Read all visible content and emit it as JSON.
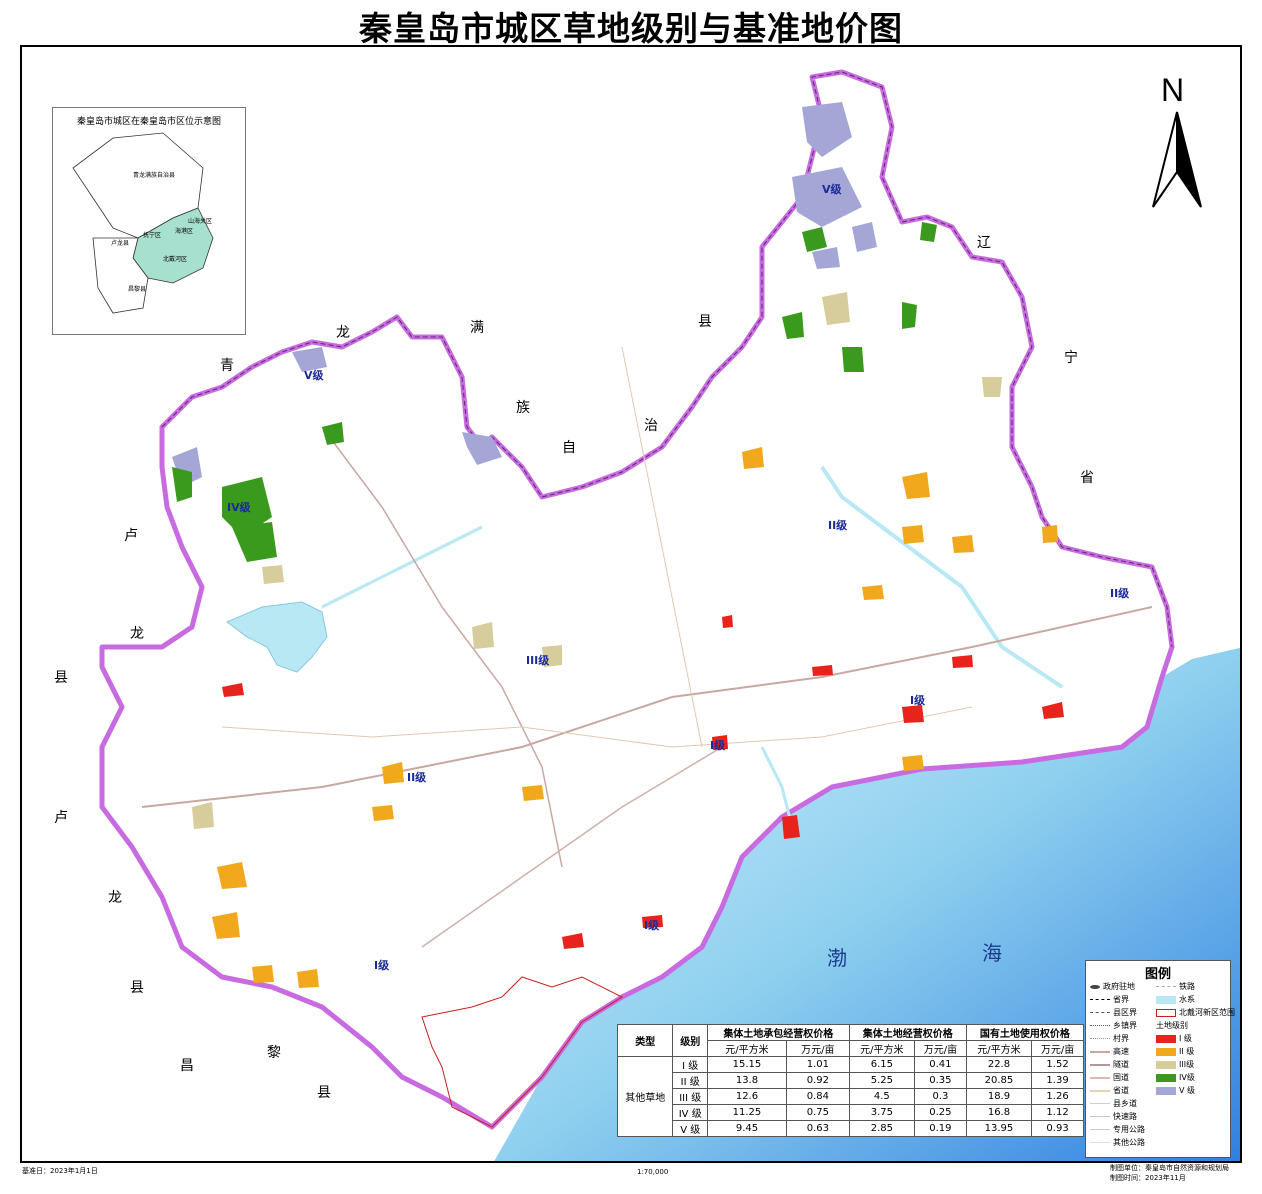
{
  "title": "秦皇岛市城区草地级别与基准地价图",
  "inset": {
    "title": "秦皇岛市城区在秦皇岛市区位示意图",
    "labels": [
      "青龙满族自治县",
      "抚宁区",
      "海港区",
      "卢龙县",
      "北戴河区",
      "山海关区",
      "昌黎县"
    ]
  },
  "compass": {
    "label": "N"
  },
  "place_labels": {
    "qinglong": [
      "青",
      "龙",
      "满",
      "族",
      "自",
      "治",
      "县"
    ],
    "liaoning": [
      "辽",
      "宁",
      "省"
    ],
    "lulong_top": [
      "卢",
      "龙",
      "县"
    ],
    "lulong_bottom": [
      "卢",
      "龙",
      "县"
    ],
    "changli": [
      "昌",
      "黎",
      "县"
    ],
    "bohai": [
      "渤",
      "海"
    ]
  },
  "grade_labels": [
    "V级",
    "V级",
    "IV级",
    "III级",
    "II级",
    "II级",
    "II级",
    "I级",
    "I级",
    "I级",
    "I级"
  ],
  "colors": {
    "grade_I": "#e8231c",
    "grade_II": "#f2a81d",
    "grade_III": "#d6cc9c",
    "grade_IV": "#3a9a1e",
    "grade_V": "#a4a6d6",
    "sea": "#3a8fe0",
    "sea_light": "#bfeaf5",
    "boundary": "#c86ae0",
    "water": "#b8e8f4"
  },
  "table": {
    "headers": {
      "type": "类型",
      "grade": "级别",
      "col1": "集体土地承包经营权价格",
      "col2": "集体土地经营权价格",
      "col3": "国有土地使用权价格"
    },
    "units": [
      "元/平方米",
      "万元/亩",
      "元/平方米",
      "万元/亩",
      "元/平方米",
      "万元/亩"
    ],
    "category": "其他草地",
    "rows": [
      {
        "grade": "I 级",
        "values": [
          "15.15",
          "1.01",
          "6.15",
          "0.41",
          "22.8",
          "1.52"
        ]
      },
      {
        "grade": "II 级",
        "values": [
          "13.8",
          "0.92",
          "5.25",
          "0.35",
          "20.85",
          "1.39"
        ]
      },
      {
        "grade": "III 级",
        "values": [
          "12.6",
          "0.84",
          "4.5",
          "0.3",
          "18.9",
          "1.26"
        ]
      },
      {
        "grade": "IV 级",
        "values": [
          "11.25",
          "0.75",
          "3.75",
          "0.25",
          "16.8",
          "1.12"
        ]
      },
      {
        "grade": "V 级",
        "values": [
          "9.45",
          "0.63",
          "2.85",
          "0.19",
          "13.95",
          "0.93"
        ]
      }
    ]
  },
  "legend": {
    "title": "图例",
    "left_items": [
      "政府驻地",
      "省界",
      "县区界",
      "乡镇界",
      "村界",
      "高速",
      "隧道",
      "国道",
      "省道",
      "县乡道",
      "快速路",
      "专用公路",
      "其他公路"
    ],
    "right_items": [
      "铁路",
      "水系",
      "北戴河新区范围",
      "土地级别",
      "I 级",
      "II 级",
      "III级",
      "IV级",
      "V 级"
    ]
  },
  "footer": {
    "base_date": "基准日：2023年1月1日",
    "scale": "1:70,000",
    "producer": "制图单位：秦皇岛市自然资源和规划局",
    "date": "制图时间：2023年11月"
  }
}
